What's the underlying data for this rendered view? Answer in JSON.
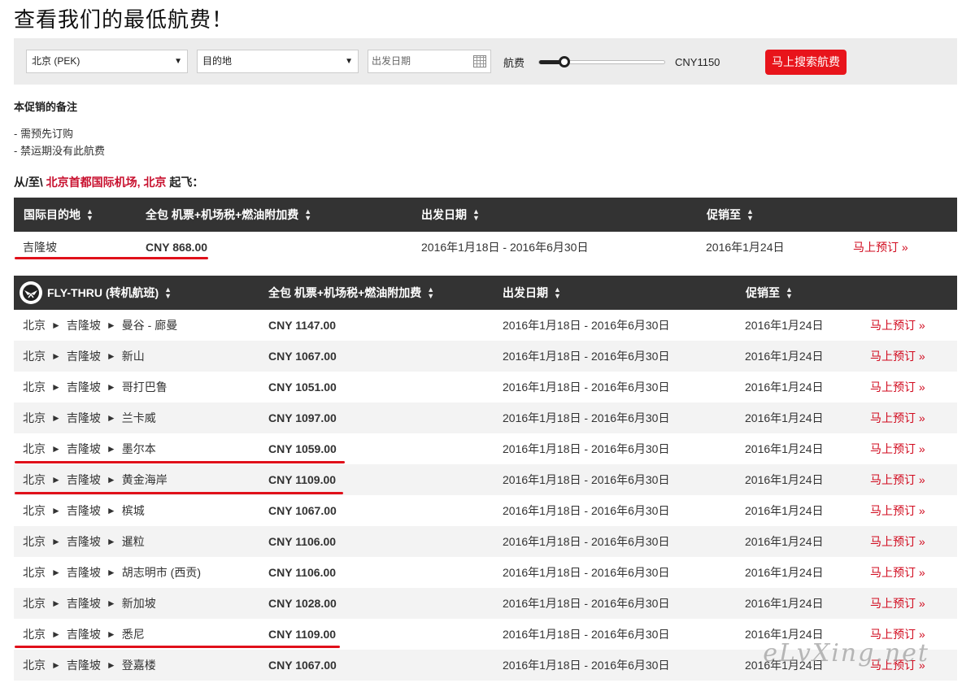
{
  "page": {
    "title": "查看我们的最低航费！"
  },
  "search": {
    "origin": "北京 (PEK)",
    "destination": "目的地",
    "date_placeholder": "出发日期",
    "fare_label": "航费",
    "fare_value": "CNY1150",
    "fare_slider_fraction": 0.2,
    "button": "马上搜索航费"
  },
  "notes": {
    "title": "本促销的备注",
    "items": [
      "- 需预先订购",
      "- 禁运期没有此航费"
    ]
  },
  "from": {
    "prefix": "从/至\\ ",
    "airport": "北京首都国际机场, 北京",
    "suffix": " 起飞："
  },
  "intl": {
    "headers": [
      "国际目的地",
      "全包 机票+机场税+燃油附加费",
      "出发日期",
      "促销至"
    ],
    "rows": [
      {
        "dest": "吉隆坡",
        "price": "CNY 868.00",
        "dates": "2016年1月18日 - 2016年6月30日",
        "until": "2016年1月24日",
        "book": "马上预订 »"
      }
    ]
  },
  "thru": {
    "headers": [
      "FLY-THRU (转机航班)",
      "全包 机票+机场税+燃油附加费",
      "出发日期",
      "促销至"
    ],
    "arrow": "►",
    "rows": [
      {
        "from": "北京",
        "via": "吉隆坡",
        "to": "曼谷 - 廊曼",
        "price": "CNY 1147.00",
        "dates": "2016年1月18日 - 2016年6月30日",
        "until": "2016年1月24日",
        "book": "马上预订 »"
      },
      {
        "from": "北京",
        "via": "吉隆坡",
        "to": "新山",
        "price": "CNY 1067.00",
        "dates": "2016年1月18日 - 2016年6月30日",
        "until": "2016年1月24日",
        "book": "马上预订 »"
      },
      {
        "from": "北京",
        "via": "吉隆坡",
        "to": "哥打巴鲁",
        "price": "CNY 1051.00",
        "dates": "2016年1月18日 - 2016年6月30日",
        "until": "2016年1月24日",
        "book": "马上预订 »"
      },
      {
        "from": "北京",
        "via": "吉隆坡",
        "to": "兰卡威",
        "price": "CNY 1097.00",
        "dates": "2016年1月18日 - 2016年6月30日",
        "until": "2016年1月24日",
        "book": "马上预订 »"
      },
      {
        "from": "北京",
        "via": "吉隆坡",
        "to": "墨尔本",
        "price": "CNY 1059.00",
        "dates": "2016年1月18日 - 2016年6月30日",
        "until": "2016年1月24日",
        "book": "马上预订 »"
      },
      {
        "from": "北京",
        "via": "吉隆坡",
        "to": "黄金海岸",
        "price": "CNY 1109.00",
        "dates": "2016年1月18日 - 2016年6月30日",
        "until": "2016年1月24日",
        "book": "马上预订 »"
      },
      {
        "from": "北京",
        "via": "吉隆坡",
        "to": "槟城",
        "price": "CNY 1067.00",
        "dates": "2016年1月18日 - 2016年6月30日",
        "until": "2016年1月24日",
        "book": "马上预订 »"
      },
      {
        "from": "北京",
        "via": "吉隆坡",
        "to": "暹粒",
        "price": "CNY 1106.00",
        "dates": "2016年1月18日 - 2016年6月30日",
        "until": "2016年1月24日",
        "book": "马上预订 »"
      },
      {
        "from": "北京",
        "via": "吉隆坡",
        "to": "胡志明市 (西贡)",
        "price": "CNY 1106.00",
        "dates": "2016年1月18日 - 2016年6月30日",
        "until": "2016年1月24日",
        "book": "马上预订 »"
      },
      {
        "from": "北京",
        "via": "吉隆坡",
        "to": "新加坡",
        "price": "CNY 1028.00",
        "dates": "2016年1月18日 - 2016年6月30日",
        "until": "2016年1月24日",
        "book": "马上预订 »"
      },
      {
        "from": "北京",
        "via": "吉隆坡",
        "to": "悉尼",
        "price": "CNY 1109.00",
        "dates": "2016年1月18日 - 2016年6月30日",
        "until": "2016年1月24日",
        "book": "马上预订 »"
      },
      {
        "from": "北京",
        "via": "吉隆坡",
        "to": "登嘉楼",
        "price": "CNY 1067.00",
        "dates": "2016年1月18日 - 2016年6月30日",
        "until": "2016年1月24日",
        "book": "马上预订 »"
      }
    ]
  },
  "watermark": "eLvXing.net",
  "colors": {
    "accent": "#e8141b",
    "header_bg": "#333333",
    "row_alt": "#f3f3f3",
    "link": "#d10a1e"
  }
}
